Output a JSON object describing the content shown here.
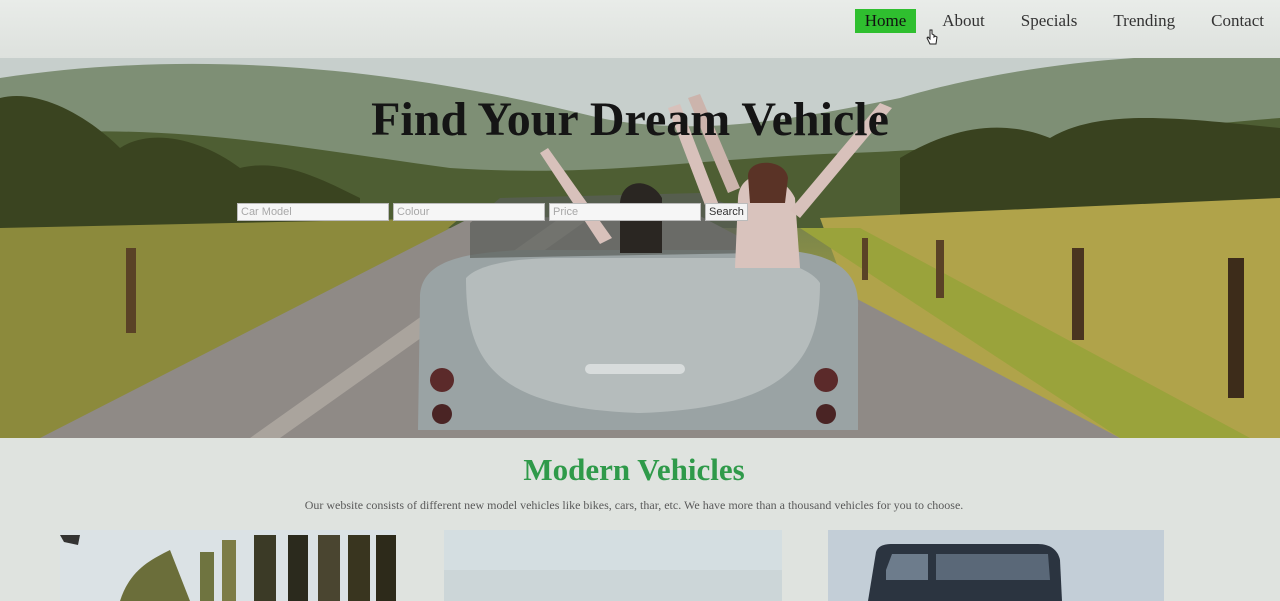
{
  "nav": {
    "items": [
      {
        "label": "Home",
        "active": true
      },
      {
        "label": "About",
        "active": false
      },
      {
        "label": "Specials",
        "active": false
      },
      {
        "label": "Trending",
        "active": false
      },
      {
        "label": "Contact",
        "active": false
      }
    ]
  },
  "hero": {
    "title": "Find Your Dream Vehicle",
    "search": {
      "model_placeholder": "Car Model",
      "colour_placeholder": "Colour",
      "price_placeholder": "Price",
      "button_label": "Search"
    }
  },
  "section": {
    "title": "Modern Vehicles",
    "description": "Our website consists of different new model vehicles like bikes, cars, thar, etc. We have more than a thousand vehicles for you to choose."
  },
  "colors": {
    "nav_active": "#2fbf2f",
    "section_title": "#2f9a4a"
  }
}
